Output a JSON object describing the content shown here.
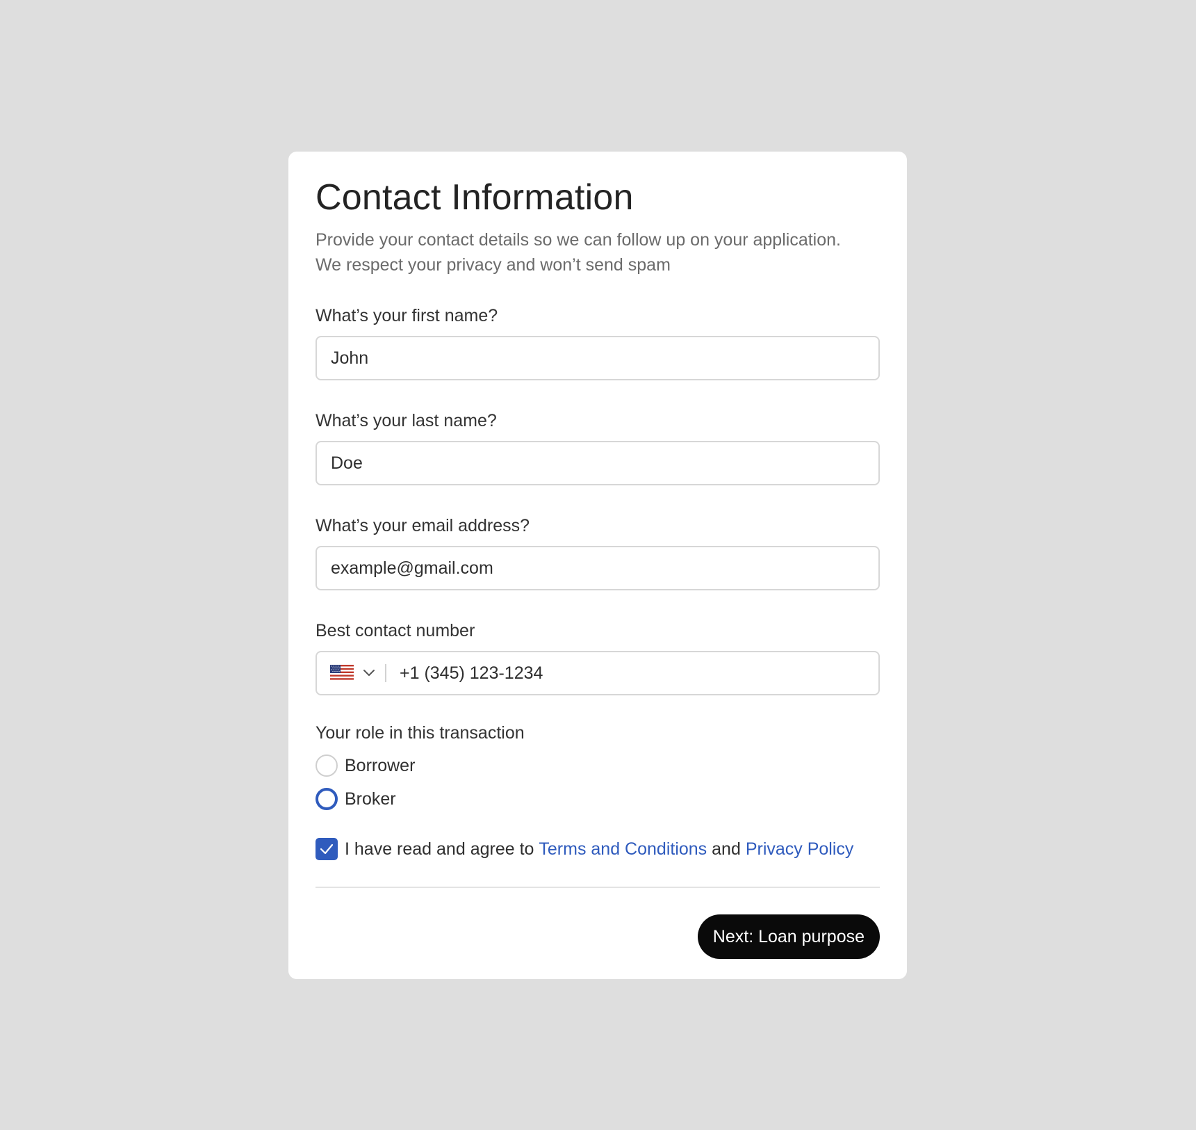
{
  "form": {
    "title": "Contact Information",
    "subtitle_lines": [
      "Provide your contact details so we can follow up on your application.",
      "We respect your privacy and won’t send spam"
    ],
    "first_name": {
      "label": "What’s your first name?",
      "value": "John"
    },
    "last_name": {
      "label": "What’s your last name?",
      "value": "Doe"
    },
    "email": {
      "label": "What’s your email address?",
      "value": "example@gmail.com"
    },
    "phone": {
      "label": "Best contact number",
      "country_flag_icon": "us-flag-icon",
      "value": "+1 (345) 123-1234"
    },
    "role": {
      "label": "Your role in this transaction",
      "options": [
        {
          "label": "Borrower",
          "selected": false
        },
        {
          "label": "Broker",
          "selected": true
        }
      ]
    },
    "agreement": {
      "checked": true,
      "prefix": "I have read and agree to",
      "terms_link": "Terms and Conditions",
      "conjunction": "and",
      "privacy_link": "Privacy Policy"
    },
    "next_button": "Next: Loan purpose"
  },
  "colors": {
    "background": "#dedede",
    "card": "#ffffff",
    "accent": "#2f5bbd",
    "button": "#0a0a0a"
  }
}
